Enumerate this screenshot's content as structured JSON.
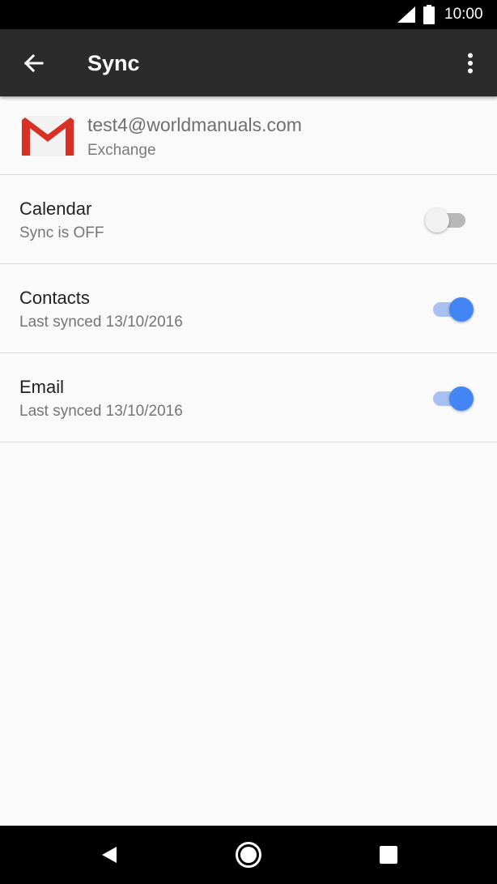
{
  "status_bar": {
    "time": "10:00",
    "icons": [
      "signal-icon",
      "battery-icon"
    ]
  },
  "app_bar": {
    "title": "Sync",
    "icons": [
      "back-arrow-icon",
      "more-vert-icon"
    ]
  },
  "account": {
    "email": "test4@worldmanuals.com",
    "type": "Exchange",
    "icon": "gmail-icon"
  },
  "sync_items": [
    {
      "label": "Calendar",
      "status": "Sync is OFF",
      "enabled": false
    },
    {
      "label": "Contacts",
      "status": "Last synced 13/10/2016",
      "enabled": true
    },
    {
      "label": "Email",
      "status": "Last synced 13/10/2016",
      "enabled": true
    }
  ],
  "nav_bar": {
    "icons": [
      "back-triangle-icon",
      "home-circle-icon",
      "recents-square-icon"
    ]
  },
  "colors": {
    "app_bar": "#2b2b2b",
    "accent": "#4285f4",
    "gmail_red": "#d93025"
  }
}
